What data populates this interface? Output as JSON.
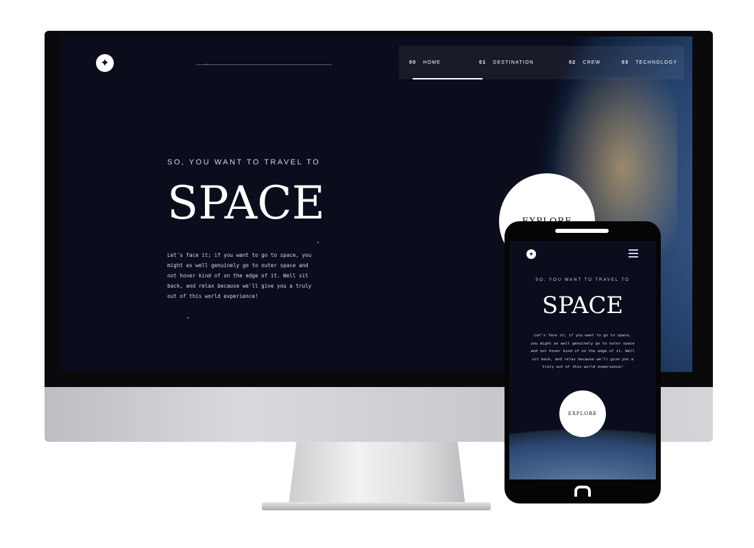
{
  "desktop": {
    "nav": [
      {
        "num": "00",
        "label": "HOME",
        "active": true
      },
      {
        "num": "01",
        "label": "DESTINATION"
      },
      {
        "num": "02",
        "label": "CREW"
      },
      {
        "num": "03",
        "label": "TECHNOLOGY"
      }
    ],
    "eyebrow": "SO, YOU WANT TO TRAVEL TO",
    "title": "SPACE",
    "paragraph": "Let's face it; if you want to go to space, you might as well genuinely go to outer space and not hover kind of on the edge of it. Well sit back, and relax because we'll give you a truly out of this world experience!",
    "explore": "EXPLORE"
  },
  "mobile": {
    "eyebrow": "SO, YOU WANT TO TRAVEL TO",
    "title": "SPACE",
    "paragraph": "Let's face it; if you want to go to space, you might as well genuinely go to outer space and not hover kind of on the edge of it. Well sit back, and relax because we'll give you a truly out of this world experience!",
    "explore": "EXPLORE"
  }
}
